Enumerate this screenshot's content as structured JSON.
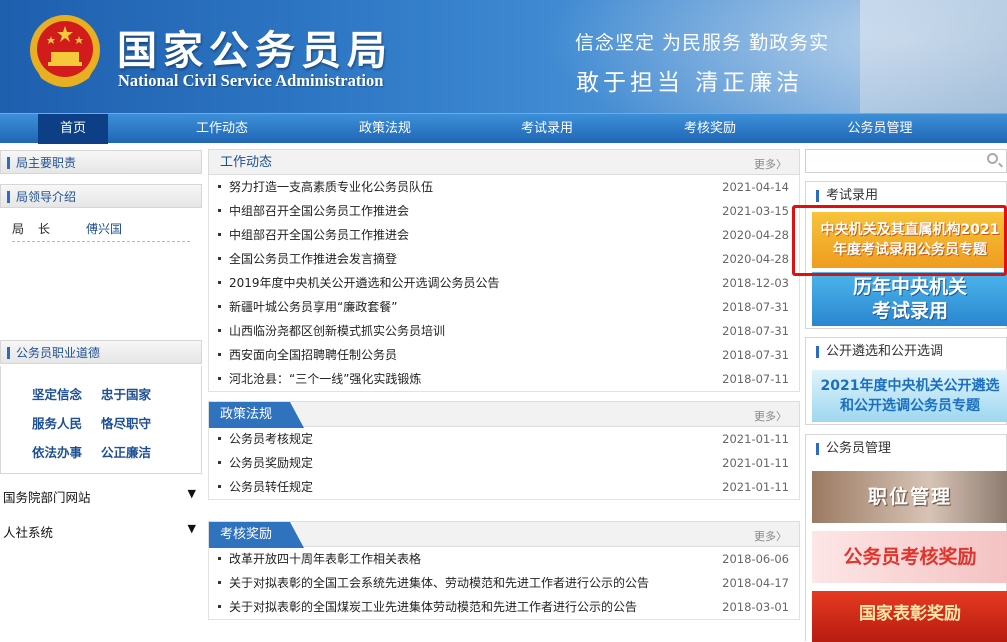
{
  "header": {
    "title": "国家公务员局",
    "subtitle": "National Civil Service Administration",
    "slogan_line1": "信念坚定  为民服务  勤政务实",
    "slogan_line2": "敢于担当   清正廉洁"
  },
  "nav": {
    "items": [
      "首页",
      "工作动态",
      "政策法规",
      "考试录用",
      "考核奖励",
      "公务员管理"
    ],
    "active": "首页"
  },
  "left": {
    "duties": "局主要职责",
    "leaders_header": "局领导介绍",
    "leader_title": "局长",
    "leader_name": "傅兴国",
    "ethics_header": "公务员职业道德",
    "ethics": [
      "坚定信念",
      "忠于国家",
      "服务人民",
      "恪尽职守",
      "依法办事",
      "公正廉洁"
    ],
    "link1": "国务院部门网站",
    "link2": "人社系统"
  },
  "center": {
    "news": {
      "title": "工作动态",
      "more": "更多",
      "items": [
        {
          "text": "努力打造一支高素质专业化公务员队伍",
          "date": "2021-04-14"
        },
        {
          "text": "中组部召开全国公务员工作推进会",
          "date": "2021-03-15"
        },
        {
          "text": "中组部召开全国公务员工作推进会",
          "date": "2020-04-28"
        },
        {
          "text": "全国公务员工作推进会发言摘登",
          "date": "2020-04-28"
        },
        {
          "text": "2019年度中央机关公开遴选和公开选调公务员公告",
          "date": "2018-12-03"
        },
        {
          "text": "新疆叶城公务员享用“廉政套餐”",
          "date": "2018-07-31"
        },
        {
          "text": "山西临汾尧都区创新模式抓实公务员培训",
          "date": "2018-07-31"
        },
        {
          "text": "西安面向全国招聘聘任制公务员",
          "date": "2018-07-31"
        },
        {
          "text": "河北沧县：“三个一线”强化实践锻炼",
          "date": "2018-07-11"
        }
      ]
    },
    "policy": {
      "title": "政策法规",
      "more": "更多",
      "items": [
        {
          "text": "公务员考核规定",
          "date": "2021-01-11"
        },
        {
          "text": "公务员奖励规定",
          "date": "2021-01-11"
        },
        {
          "text": "公务员转任规定",
          "date": "2021-01-11"
        }
      ]
    },
    "rewards": {
      "title": "考核奖励",
      "more": "更多",
      "items": [
        {
          "text": "改革开放四十周年表彰工作相关表格",
          "date": "2018-06-06"
        },
        {
          "text": "关于对拟表彰的全国工会系统先进集体、劳动模范和先进工作者进行公示的公告",
          "date": "2018-04-17"
        },
        {
          "text": "关于对拟表彰的全国煤炭工业先进集体劳动模范和先进工作者进行公示的公告",
          "date": "2018-03-01"
        }
      ]
    }
  },
  "right": {
    "search_placeholder": "",
    "exam_header": "考试录用",
    "exam_banner1_line1": "中央机关及其直属机构2021",
    "exam_banner1_line2": "年度考试录用公务员专题",
    "exam_banner2_line1": "历年中央机关",
    "exam_banner2_line2": "考试录用",
    "select_header": "公开遴选和公开选调",
    "select_banner_line1": "2021年度中央机关公开遴选",
    "select_banner_line2": "和公开选调公务员专题",
    "mgmt_header": "公务员管理",
    "mgmt_banner1": "职位管理",
    "mgmt_banner2": "公务员考核奖励",
    "mgmt_banner3": "国家表彰奖励"
  },
  "colors": {
    "header_blue": "#2f79c6",
    "nav_active": "#0c3f86",
    "link_blue": "#1d4f94",
    "highlight_red": "#e01010",
    "banner_orange": "#f0a020"
  }
}
